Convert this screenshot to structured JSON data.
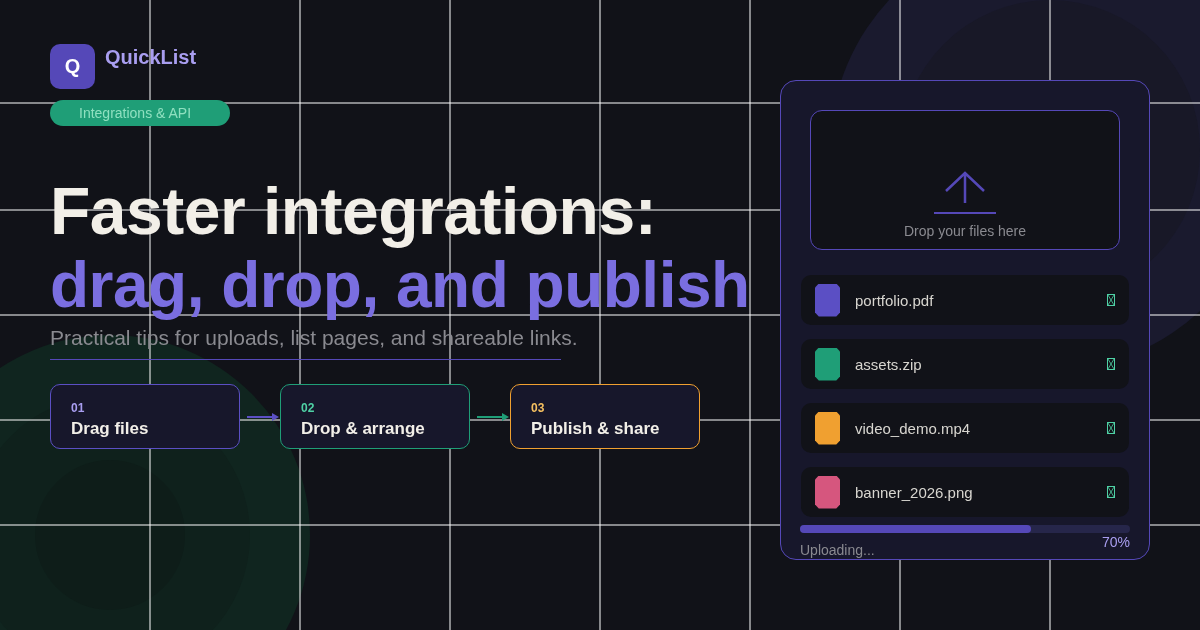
{
  "brand": {
    "logo_letter": "Q",
    "name": "QuickList"
  },
  "tag": "Integrations & API",
  "headline": {
    "line_1": "Faster integrations:",
    "line_2": "drag, drop, and publish"
  },
  "subtitle": "Practical tips for uploads, list pages, and shareable links.",
  "steps": [
    {
      "number": "01",
      "label": "Drag files",
      "color": "#5b4fc4"
    },
    {
      "number": "02",
      "label": "Drop & arrange",
      "color": "#1f9e77"
    },
    {
      "number": "03",
      "label": "Publish & share",
      "color": "#f0a030"
    }
  ],
  "upload_card": {
    "drop_zone": {
      "text": "Drop your files here"
    },
    "files": [
      {
        "name": "portfolio.pdf",
        "color": "#5b4fc4"
      },
      {
        "name": "assets.zip",
        "color": "#1f9e77"
      },
      {
        "name": "video_demo.mp4",
        "color": "#f0a030"
      },
      {
        "name": "banner_2026.png",
        "color": "#d6567e"
      }
    ],
    "progress": {
      "level": 0.7,
      "reading": "70%",
      "status": "Uploading..."
    }
  }
}
